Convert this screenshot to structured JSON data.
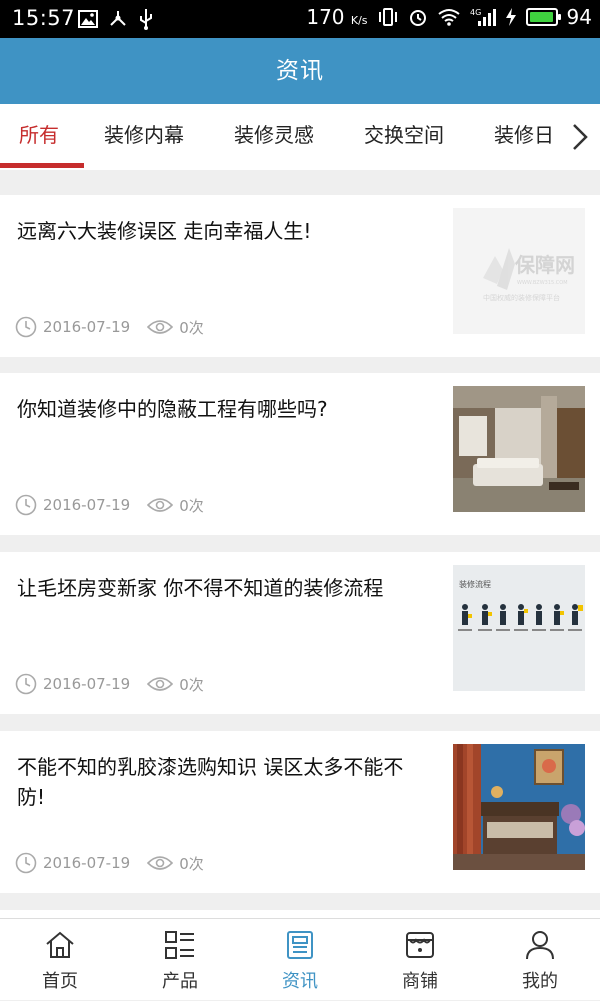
{
  "status_bar": {
    "time": "15:57",
    "speed_value": "170",
    "speed_unit": "K/s",
    "network": "4G",
    "battery": "94",
    "battery_level": 0.94
  },
  "header": {
    "title": "资讯"
  },
  "tabs": [
    {
      "label": "所有",
      "active": true
    },
    {
      "label": "装修内幕"
    },
    {
      "label": "装修灵感"
    },
    {
      "label": "交换空间"
    },
    {
      "label": "装修日"
    }
  ],
  "articles": [
    {
      "title": "远离六大装修误区 走向幸福人生!",
      "date": "2016-07-19",
      "views": "0次",
      "thumb": "logo-placeholder",
      "logo_text": "保障网",
      "logo_sub": "中国权威的装修保障平台"
    },
    {
      "title": "你知道装修中的隐蔽工程有哪些吗?",
      "date": "2016-07-19",
      "views": "0次",
      "thumb": "living-room-photo"
    },
    {
      "title": "让毛坯房变新家 你不得不知道的装修流程",
      "date": "2016-07-19",
      "views": "0次",
      "thumb": "process-figures",
      "thumb_label": "装修流程"
    },
    {
      "title": "不能不知的乳胶漆选购知识 误区太多不能不防!",
      "date": "2016-07-19",
      "views": "0次",
      "thumb": "blue-bedroom-photo"
    }
  ],
  "bottom_nav": [
    {
      "label": "首页",
      "icon": "home-icon"
    },
    {
      "label": "产品",
      "icon": "grid-list-icon"
    },
    {
      "label": "资讯",
      "icon": "news-icon",
      "active": true
    },
    {
      "label": "商铺",
      "icon": "store-icon"
    },
    {
      "label": "我的",
      "icon": "user-icon"
    }
  ],
  "colors": {
    "primary": "#3f93c4",
    "tab_active": "#c62d2d",
    "meta": "#999999"
  }
}
